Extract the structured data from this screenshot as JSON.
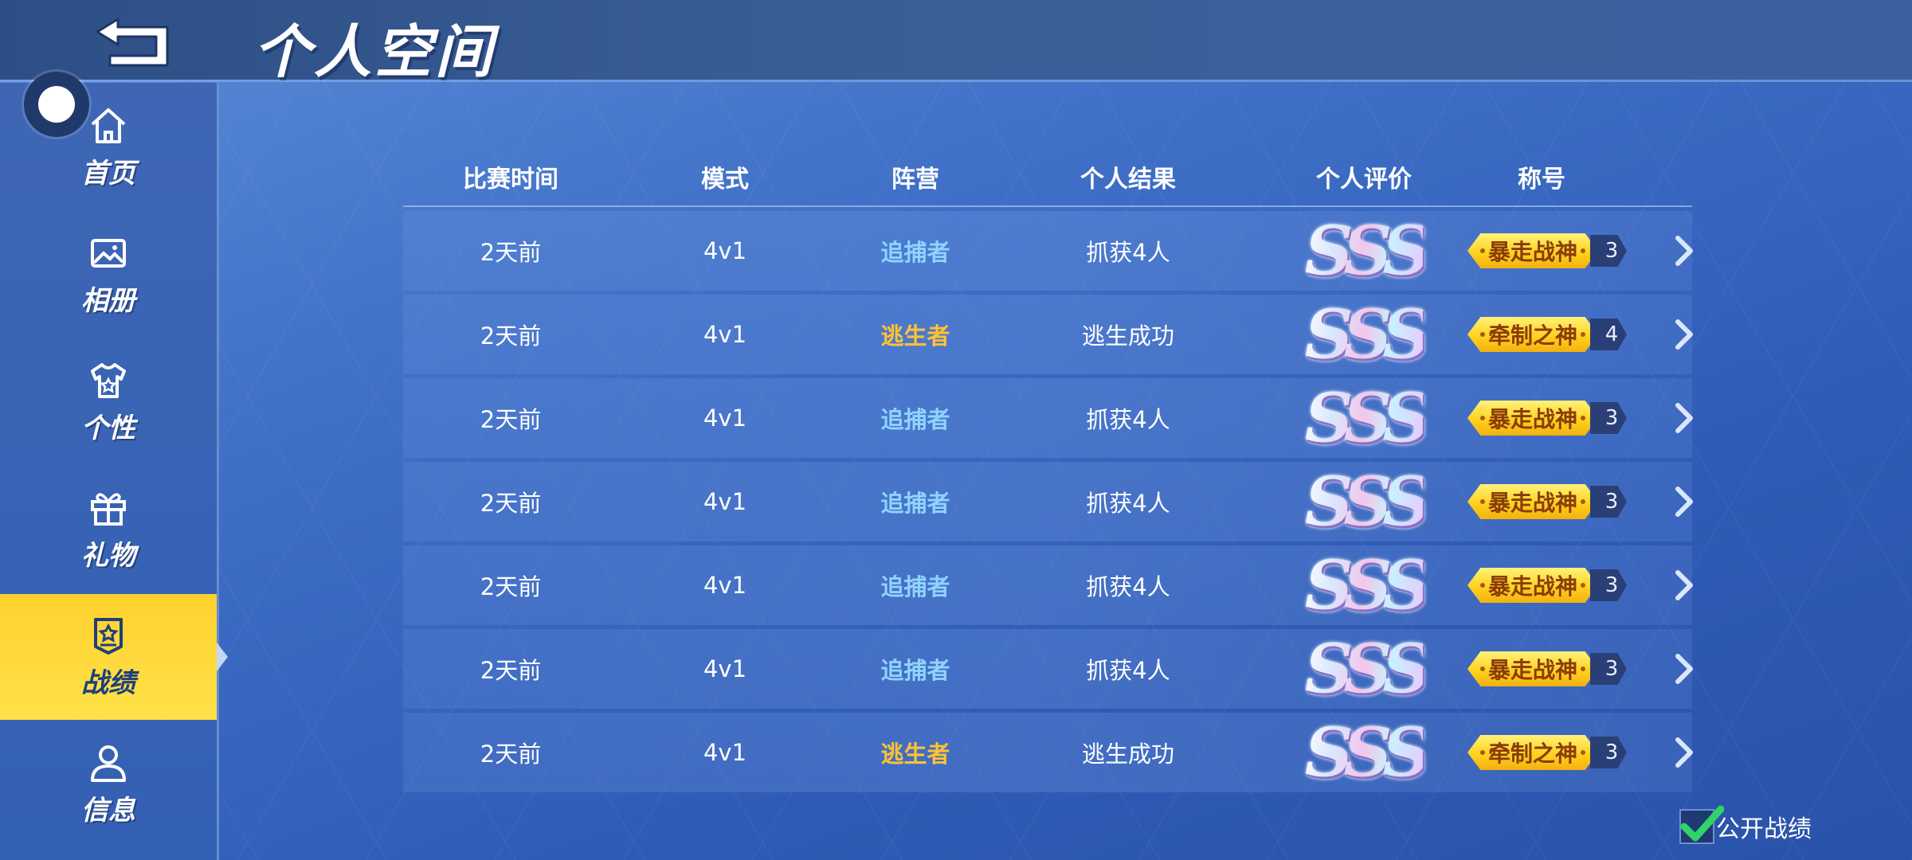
{
  "header": {
    "title": "个人空间"
  },
  "sidebar": {
    "items": [
      {
        "label": "首页",
        "icon": "home-icon",
        "active": false
      },
      {
        "label": "相册",
        "icon": "image-icon",
        "active": false
      },
      {
        "label": "个性",
        "icon": "shirt-icon",
        "active": false
      },
      {
        "label": "礼物",
        "icon": "gift-icon",
        "active": false
      },
      {
        "label": "战绩",
        "icon": "badge-star-icon",
        "active": true
      },
      {
        "label": "信息",
        "icon": "user-icon",
        "active": false
      }
    ]
  },
  "table": {
    "headers": [
      "比赛时间",
      "模式",
      "阵营",
      "个人结果",
      "个人评价",
      "称号"
    ],
    "rows": [
      {
        "time": "2天前",
        "mode": "4v1",
        "camp": "追捕者",
        "camp_type": "hunter",
        "result": "抓获4人",
        "rating": "SSS",
        "title": "暴走战神",
        "title_count": "3"
      },
      {
        "time": "2天前",
        "mode": "4v1",
        "camp": "逃生者",
        "camp_type": "escapee",
        "result": "逃生成功",
        "rating": "SSS",
        "title": "牵制之神",
        "title_count": "4"
      },
      {
        "time": "2天前",
        "mode": "4v1",
        "camp": "追捕者",
        "camp_type": "hunter",
        "result": "抓获4人",
        "rating": "SSS",
        "title": "暴走战神",
        "title_count": "3"
      },
      {
        "time": "2天前",
        "mode": "4v1",
        "camp": "追捕者",
        "camp_type": "hunter",
        "result": "抓获4人",
        "rating": "SSS",
        "title": "暴走战神",
        "title_count": "3"
      },
      {
        "time": "2天前",
        "mode": "4v1",
        "camp": "追捕者",
        "camp_type": "hunter",
        "result": "抓获4人",
        "rating": "SSS",
        "title": "暴走战神",
        "title_count": "3"
      },
      {
        "time": "2天前",
        "mode": "4v1",
        "camp": "追捕者",
        "camp_type": "hunter",
        "result": "抓获4人",
        "rating": "SSS",
        "title": "暴走战神",
        "title_count": "3"
      },
      {
        "time": "2天前",
        "mode": "4v1",
        "camp": "逃生者",
        "camp_type": "escapee",
        "result": "逃生成功",
        "rating": "SSS",
        "title": "牵制之神",
        "title_count": "3"
      }
    ]
  },
  "public_record": {
    "label": "公开战绩",
    "checked": true
  },
  "colors": {
    "hunter": "#8fd3ff",
    "escapee": "#ffc234",
    "active_tab": "#ffd12e"
  }
}
